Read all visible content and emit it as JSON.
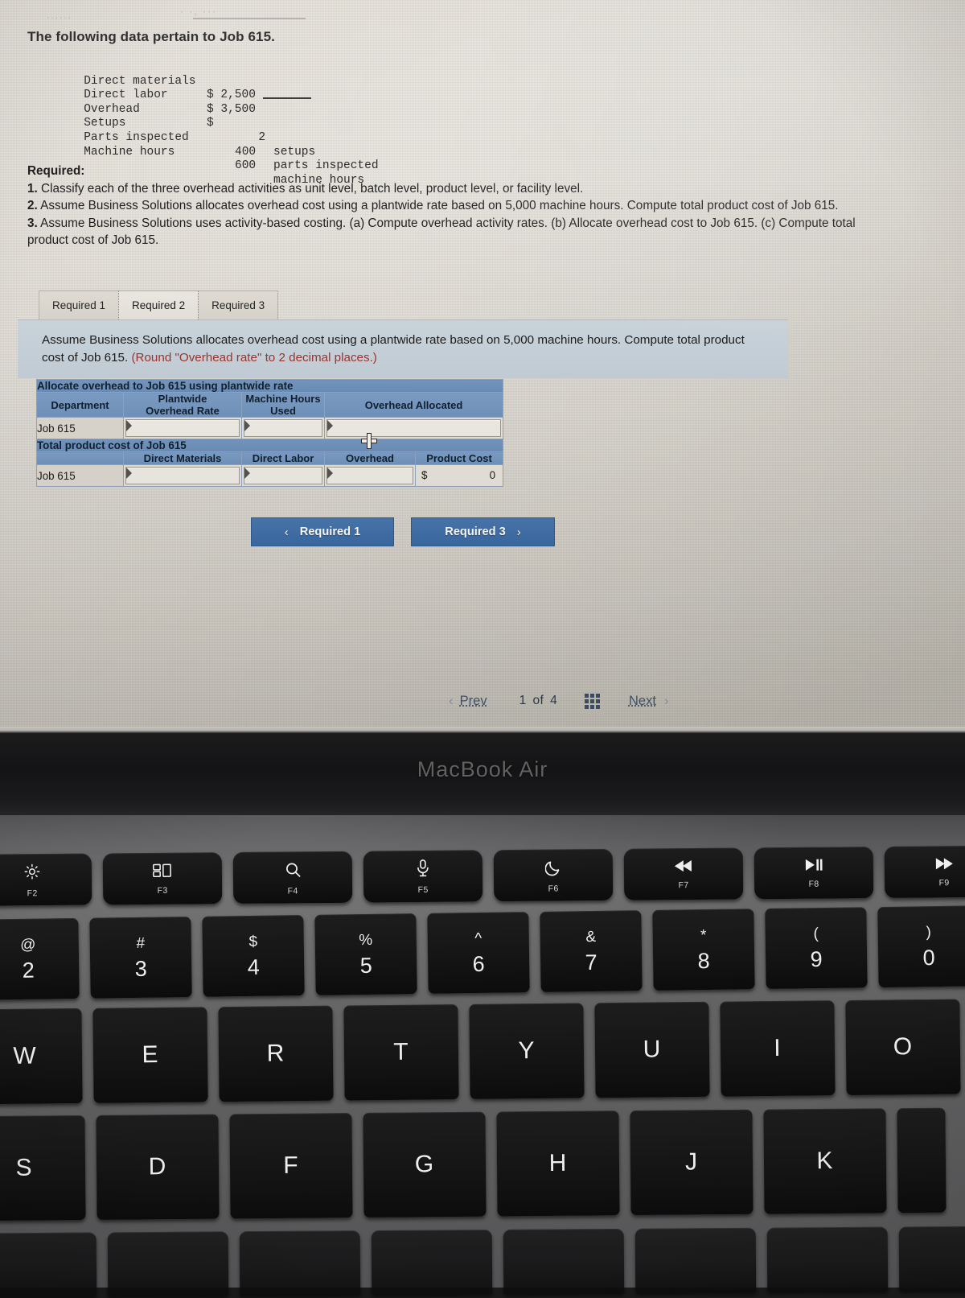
{
  "screen": {
    "top_fragment": {
      "left_dots": "......",
      "right_dots": "·  ·, ···"
    },
    "intro_line": "The following data pertain to Job 615.",
    "job_data": {
      "rows": [
        {
          "label": "Direct materials",
          "amount": "$ 2,500",
          "suffix": ""
        },
        {
          "label": "Direct labor",
          "amount": "$ 3,500",
          "suffix": ""
        },
        {
          "label": "Overhead",
          "amount": "$",
          "suffix": ""
        },
        {
          "label": "Setups",
          "amount": "  2",
          "suffix": "setups"
        },
        {
          "label": "Parts inspected",
          "amount": "400",
          "suffix": "parts inspected"
        },
        {
          "label": "Machine hours",
          "amount": "600",
          "suffix": "machine hours"
        }
      ]
    },
    "required": {
      "heading": "Required:",
      "items": [
        {
          "num": "1.",
          "text": " Classify each of the three overhead activities as unit level, batch level, product level, or facility level."
        },
        {
          "num": "2.",
          "text": " Assume Business Solutions allocates overhead cost using a plantwide rate based on 5,000 machine hours. Compute total product cost of Job 615."
        },
        {
          "num": "3.",
          "text": " Assume Business Solutions uses activity-based costing. (a) Compute overhead activity rates. (b) Allocate overhead cost to Job 615. (c) Compute total product cost of Job 615."
        }
      ]
    },
    "tabs": [
      {
        "label": "Required 1",
        "active": false
      },
      {
        "label": "Required 2",
        "active": true
      },
      {
        "label": "Required 3",
        "active": false
      }
    ],
    "prompt": {
      "main": "Assume Business Solutions allocates overhead cost using a plantwide rate based on 5,000 machine hours. Compute total product cost of Job 615. ",
      "hint": "(Round \"Overhead rate\" to 2 decimal places.)",
      "hint_color": "#a0342c"
    },
    "sheet": {
      "table1": {
        "band": "Allocate overhead to Job 615 using plantwide rate",
        "headers": [
          "Department",
          "Plantwide Overhead Rate",
          "Machine Hours Used",
          "Overhead Allocated"
        ],
        "headers_wrapped": [
          [
            "Department",
            ""
          ],
          [
            "Plantwide",
            "Overhead Rate"
          ],
          [
            "Machine Hours",
            "Used"
          ],
          [
            "Overhead Allocated",
            ""
          ]
        ],
        "row_label": "Job 615",
        "cells": [
          "",
          "",
          ""
        ]
      },
      "table2": {
        "band": "Total product cost of Job 615",
        "headers": [
          "",
          "Direct Materials",
          "Direct Labor",
          "Overhead",
          "Product Cost"
        ],
        "row_label": "Job 615",
        "cells": [
          "",
          "",
          ""
        ],
        "product_cost": {
          "currency": "$",
          "value": "0"
        }
      }
    },
    "req_nav": {
      "prev": {
        "label": "Required 1",
        "chevron": "‹"
      },
      "next": {
        "label": "Required 3",
        "chevron": "›"
      }
    },
    "pager": {
      "prev_chevron": "‹",
      "prev_label": "Prev",
      "current": "1",
      "of": "of",
      "total": "4",
      "grid_icon": "grid-icon",
      "next_label": "Next",
      "next_chevron": "›"
    },
    "colors": {
      "table_band": "#6b8eb9",
      "table_header": "#7093bd",
      "button_blue": "#3a6aa4",
      "prompt_band": "#c8d3db",
      "hint_red": "#a0342c"
    }
  },
  "laptop": {
    "brand": "MacBook Air",
    "function_row": [
      {
        "fn": "F2",
        "icon": "brightness-icon",
        "glyph": "☀"
      },
      {
        "fn": "F3",
        "icon": "mission-control-icon",
        "glyph": "⎕"
      },
      {
        "fn": "F4",
        "icon": "spotlight-search-icon",
        "glyph": "⌕"
      },
      {
        "fn": "F5",
        "icon": "dictation-mic-icon",
        "glyph": "Ἲ4"
      },
      {
        "fn": "F6",
        "icon": "do-not-disturb-icon",
        "glyph": "☾"
      },
      {
        "fn": "F7",
        "icon": "rewind-icon",
        "glyph": "⏪"
      },
      {
        "fn": "F8",
        "icon": "play-pause-icon",
        "glyph": "⏯"
      },
      {
        "fn": "F9",
        "icon": "fast-forward-icon",
        "glyph": "⏩"
      }
    ],
    "number_row": [
      {
        "upper": "@",
        "lower": "2"
      },
      {
        "upper": "#",
        "lower": "3"
      },
      {
        "upper": "$",
        "lower": "4"
      },
      {
        "upper": "%",
        "lower": "5"
      },
      {
        "upper": "^",
        "lower": "6"
      },
      {
        "upper": "&",
        "lower": "7"
      },
      {
        "upper": "*",
        "lower": "8"
      },
      {
        "upper": "(",
        "lower": "9"
      },
      {
        "upper": ")",
        "lower": "0"
      }
    ],
    "qwerty_row": [
      "W",
      "E",
      "R",
      "T",
      "Y",
      "U",
      "I",
      "O"
    ],
    "asdf_row": [
      "S",
      "D",
      "F",
      "G",
      "H",
      "J",
      "K"
    ]
  }
}
